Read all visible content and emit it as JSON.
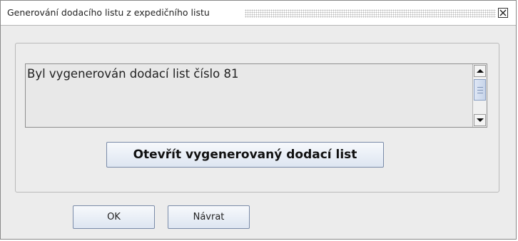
{
  "window": {
    "title": "Generování dodacího listu z expedičního listu",
    "close_icon": "close-x-icon"
  },
  "message_area": {
    "text": "Byl vygenerován dodací list číslo 81",
    "scrollbar": {
      "up_icon": "arrow-up-icon",
      "down_icon": "arrow-down-icon"
    }
  },
  "actions": {
    "open_label": "Otevřít vygenerovaný dodací list",
    "ok_label": "OK",
    "back_label": "Návrat"
  }
}
